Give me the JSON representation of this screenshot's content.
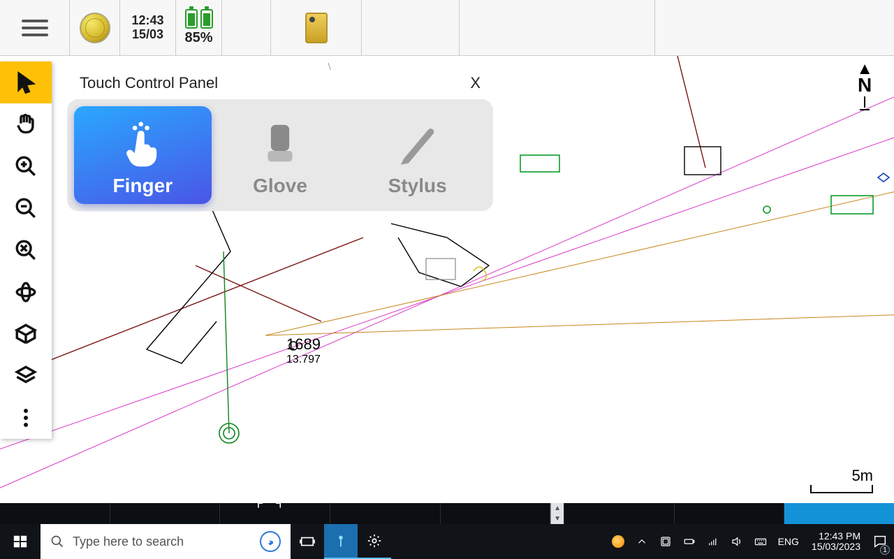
{
  "top": {
    "time": "12:43",
    "date": "15/03",
    "battery": "85%"
  },
  "panel": {
    "title": "Touch Control Panel",
    "close": "X",
    "modes": {
      "finger": "Finger",
      "glove": "Glove",
      "stylus": "Stylus"
    }
  },
  "map": {
    "point_id": "1689",
    "point_elev": "13.797",
    "north": "N",
    "scale": "5m"
  },
  "taskbar": {
    "search_placeholder": "Type here to search",
    "lang": "ENG",
    "time": "12:43 PM",
    "date": "15/03/2023",
    "notif_count": "1"
  }
}
